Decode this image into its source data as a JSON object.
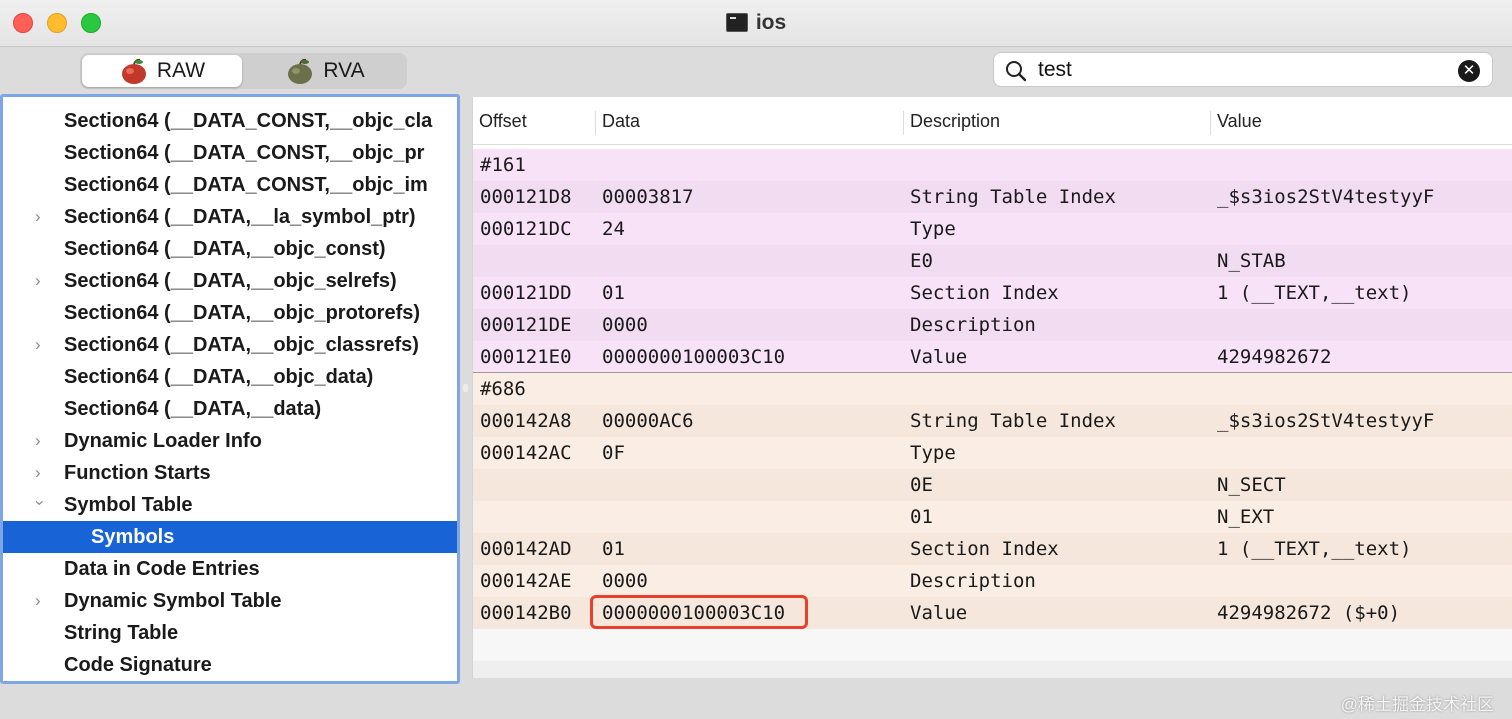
{
  "window": {
    "title": "ios"
  },
  "toolbar": {
    "raw_label": "RAW",
    "rva_label": "RVA",
    "search": {
      "value": "test",
      "placeholder": ""
    }
  },
  "sidebar": {
    "items": [
      {
        "label": "Section64 (__DATA_CONST,__objc_cla",
        "expandable": false
      },
      {
        "label": "Section64 (__DATA_CONST,__objc_pr",
        "expandable": false
      },
      {
        "label": "Section64 (__DATA_CONST,__objc_im",
        "expandable": false
      },
      {
        "label": "Section64 (__DATA,__la_symbol_ptr)",
        "expandable": true
      },
      {
        "label": "Section64 (__DATA,__objc_const)",
        "expandable": false
      },
      {
        "label": "Section64 (__DATA,__objc_selrefs)",
        "expandable": true
      },
      {
        "label": "Section64 (__DATA,__objc_protorefs)",
        "expandable": false
      },
      {
        "label": "Section64 (__DATA,__objc_classrefs)",
        "expandable": true
      },
      {
        "label": "Section64 (__DATA,__objc_data)",
        "expandable": false
      },
      {
        "label": "Section64 (__DATA,__data)",
        "expandable": false
      },
      {
        "label": "Dynamic Loader Info",
        "expandable": true
      },
      {
        "label": "Function Starts",
        "expandable": true
      },
      {
        "label": "Symbol Table",
        "expandable": true,
        "expanded": true
      },
      {
        "label": "Symbols",
        "expandable": false,
        "selected": true,
        "level": 2
      },
      {
        "label": "Data in Code Entries",
        "expandable": false
      },
      {
        "label": "Dynamic Symbol Table",
        "expandable": true
      },
      {
        "label": "String Table",
        "expandable": false
      },
      {
        "label": "Code Signature",
        "expandable": false
      }
    ]
  },
  "table": {
    "columns": [
      "Offset",
      "Data",
      "Description",
      "Value"
    ],
    "rows": [
      {
        "offset": "#161",
        "data": "",
        "desc": "",
        "value": ""
      },
      {
        "offset": "000121D8",
        "data": "00003817",
        "desc": "String Table Index",
        "value": "_$s3ios2StV4testyyF"
      },
      {
        "offset": "000121DC",
        "data": "24",
        "desc": "Type",
        "value": ""
      },
      {
        "offset": "",
        "data": "",
        "desc": "E0",
        "value": "N_STAB"
      },
      {
        "offset": "000121DD",
        "data": "01",
        "desc": "Section Index",
        "value": "1 (__TEXT,__text)"
      },
      {
        "offset": "000121DE",
        "data": "0000",
        "desc": "Description",
        "value": ""
      },
      {
        "offset": "000121E0",
        "data": "0000000100003C10",
        "desc": "Value",
        "value": "4294982672"
      },
      {
        "offset": "#686",
        "data": "",
        "desc": "",
        "value": ""
      },
      {
        "offset": "000142A8",
        "data": "00000AC6",
        "desc": "String Table Index",
        "value": "_$s3ios2StV4testyyF"
      },
      {
        "offset": "000142AC",
        "data": "0F",
        "desc": "Type",
        "value": ""
      },
      {
        "offset": "",
        "data": "",
        "desc": "0E",
        "value": "N_SECT"
      },
      {
        "offset": "",
        "data": "",
        "desc": "01",
        "value": "N_EXT"
      },
      {
        "offset": "000142AD",
        "data": "01",
        "desc": "Section Index",
        "value": "1 (__TEXT,__text)"
      },
      {
        "offset": "000142AE",
        "data": "0000",
        "desc": "Description",
        "value": ""
      },
      {
        "offset": "000142B0",
        "data": "0000000100003C10",
        "desc": "Value",
        "value": "4294982672 ($+0)"
      }
    ]
  },
  "watermark": "@稀土掘金技术社区",
  "colors": {
    "selection": "#1863d6",
    "group1": "#f8e2f8",
    "group2": "#faeee4",
    "highlight": "#e8402a"
  }
}
